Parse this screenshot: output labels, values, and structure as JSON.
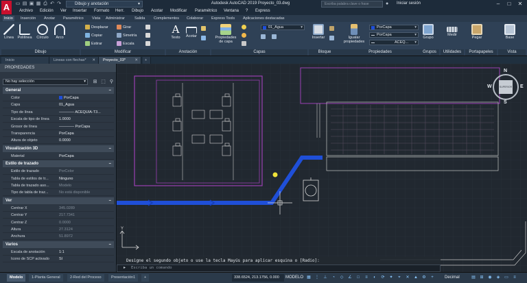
{
  "title_bar": {
    "logo_letter": "A",
    "workspace": "Dibujo y anotación",
    "app_title": "Autodesk AutoCAD 2019   Proyecto_03.dwg",
    "search_placeholder": "Escriba palabra clave o frase",
    "user": "Iniciar sesión",
    "win_minimize": "–",
    "win_maximize": "□",
    "win_close": "✕"
  },
  "menu": [
    "Archivo",
    "Edición",
    "Ver",
    "Insertar",
    "Formato",
    "Herr.",
    "Dibujo",
    "Acotar",
    "Modificar",
    "Paramétrico",
    "Ventana",
    "?",
    "Express"
  ],
  "ribbon_tabs": {
    "items": [
      "Inicio",
      "Inserción",
      "Anotar",
      "Paramétrico",
      "Vista",
      "Administrar",
      "Salida",
      "Complementos",
      "Colaborar",
      "Express Tools",
      "Aplicaciones destacadas"
    ],
    "active": 0
  },
  "ribbon": {
    "draw": {
      "label": "Dibujo",
      "line": "Línea",
      "polyline": "Polilínea",
      "circle": "Círculo",
      "arc": "Arco"
    },
    "modify": {
      "label": "Modificar",
      "move": "Desplazar",
      "copy": "Copiar",
      "stretch": "Estirar",
      "rotate": "Girar",
      "mirror": "Simetría",
      "scale": "Escala"
    },
    "annotation": {
      "label": "Anotación",
      "text": "Texto",
      "dimension": "Acotar"
    },
    "layers": {
      "label": "Capas",
      "layer_props": "Propiedades de capa",
      "current_layer": "01_Agua"
    },
    "block": {
      "label": "Bloque",
      "insert": "Insertar"
    },
    "properties": {
      "label": "Propiedades",
      "match": "Igualar propiedades",
      "color": "PorCapa",
      "lineweight": "PorCapa",
      "linetype": "ACEQ..."
    },
    "groups": {
      "label": "Grupos",
      "group": "Grupo"
    },
    "utilities": {
      "label": "Utilidades",
      "measure": "Medir"
    },
    "clipboard": {
      "label": "Portapapeles",
      "paste": "Pegar"
    },
    "view": {
      "label": "Vista",
      "base": "Base"
    }
  },
  "file_tabs": {
    "items": [
      "Inicio",
      "Lineas con flechas*",
      "Proyecto_03*"
    ],
    "active": 2,
    "close": "✕",
    "add": "+"
  },
  "properties_palette": {
    "title": "PROPIEDADES",
    "selection": "No hay selección",
    "sections": [
      {
        "name": "General",
        "rows": [
          {
            "key": "Color",
            "value": "PorCapa",
            "swatch": "#1f4fd8"
          },
          {
            "key": "Capa",
            "value": "01_Agua"
          },
          {
            "key": "Tipo de línea",
            "value": "———— ACEQUIA-T3..."
          },
          {
            "key": "Escala de tipo de línea",
            "value": "1.0000"
          },
          {
            "key": "Grosor de línea",
            "value": "———— PorCapa"
          },
          {
            "key": "Transparencia",
            "value": "PorCapa"
          },
          {
            "key": "Altura de objeto",
            "value": "0.0000"
          }
        ]
      },
      {
        "name": "Visualización 3D",
        "rows": [
          {
            "key": "Material",
            "value": "PorCapa"
          }
        ]
      },
      {
        "name": "Estilo de trazado",
        "rows": [
          {
            "key": "Estilo de trazado",
            "value": "PorColor",
            "dim": true
          },
          {
            "key": "Tabla de estilos de tr...",
            "value": "Ninguno"
          },
          {
            "key": "Tabla de trazado aso...",
            "value": "Modelo",
            "dim": true
          },
          {
            "key": "Tipo de tabla de traz...",
            "value": "No está disponible",
            "dim": true
          }
        ]
      },
      {
        "name": "Ver",
        "rows": [
          {
            "key": "Centrar X",
            "value": "345.0289",
            "dim": true
          },
          {
            "key": "Centrar Y",
            "value": "217.7341",
            "dim": true
          },
          {
            "key": "Centrar Z",
            "value": "0.0000",
            "dim": true
          },
          {
            "key": "Altura",
            "value": "27.3124",
            "dim": true
          },
          {
            "key": "Anchura",
            "value": "51.8972",
            "dim": true
          }
        ]
      },
      {
        "name": "Varios",
        "rows": [
          {
            "key": "Escala de anotación",
            "value": "1:1"
          },
          {
            "key": "Icono de SCP activado",
            "value": "Sí"
          }
        ]
      }
    ]
  },
  "viewcube": {
    "north": "N",
    "south": "S",
    "west": "W",
    "east": "E",
    "center": "SUPERIOR"
  },
  "command_line": {
    "history": "Designe el segundo objeto o use la tecla Mayús para aplicar esquina o  [Radio]:",
    "placeholder": "Escriba un comando"
  },
  "status_bar": {
    "layout_tabs": [
      "Modelo",
      "1-Planta General",
      "2-Red del Proceso",
      "Presentación1"
    ],
    "active_layout": 0,
    "coordinates": "338.6524, 213.1756, 0.000",
    "model_label": "MODELO",
    "units": "Decimal"
  },
  "colors": {
    "pipe": "#1f4fd8",
    "equipment": "#9a3fb3",
    "background": "#212830",
    "selection_marker": "#f0e33a"
  }
}
